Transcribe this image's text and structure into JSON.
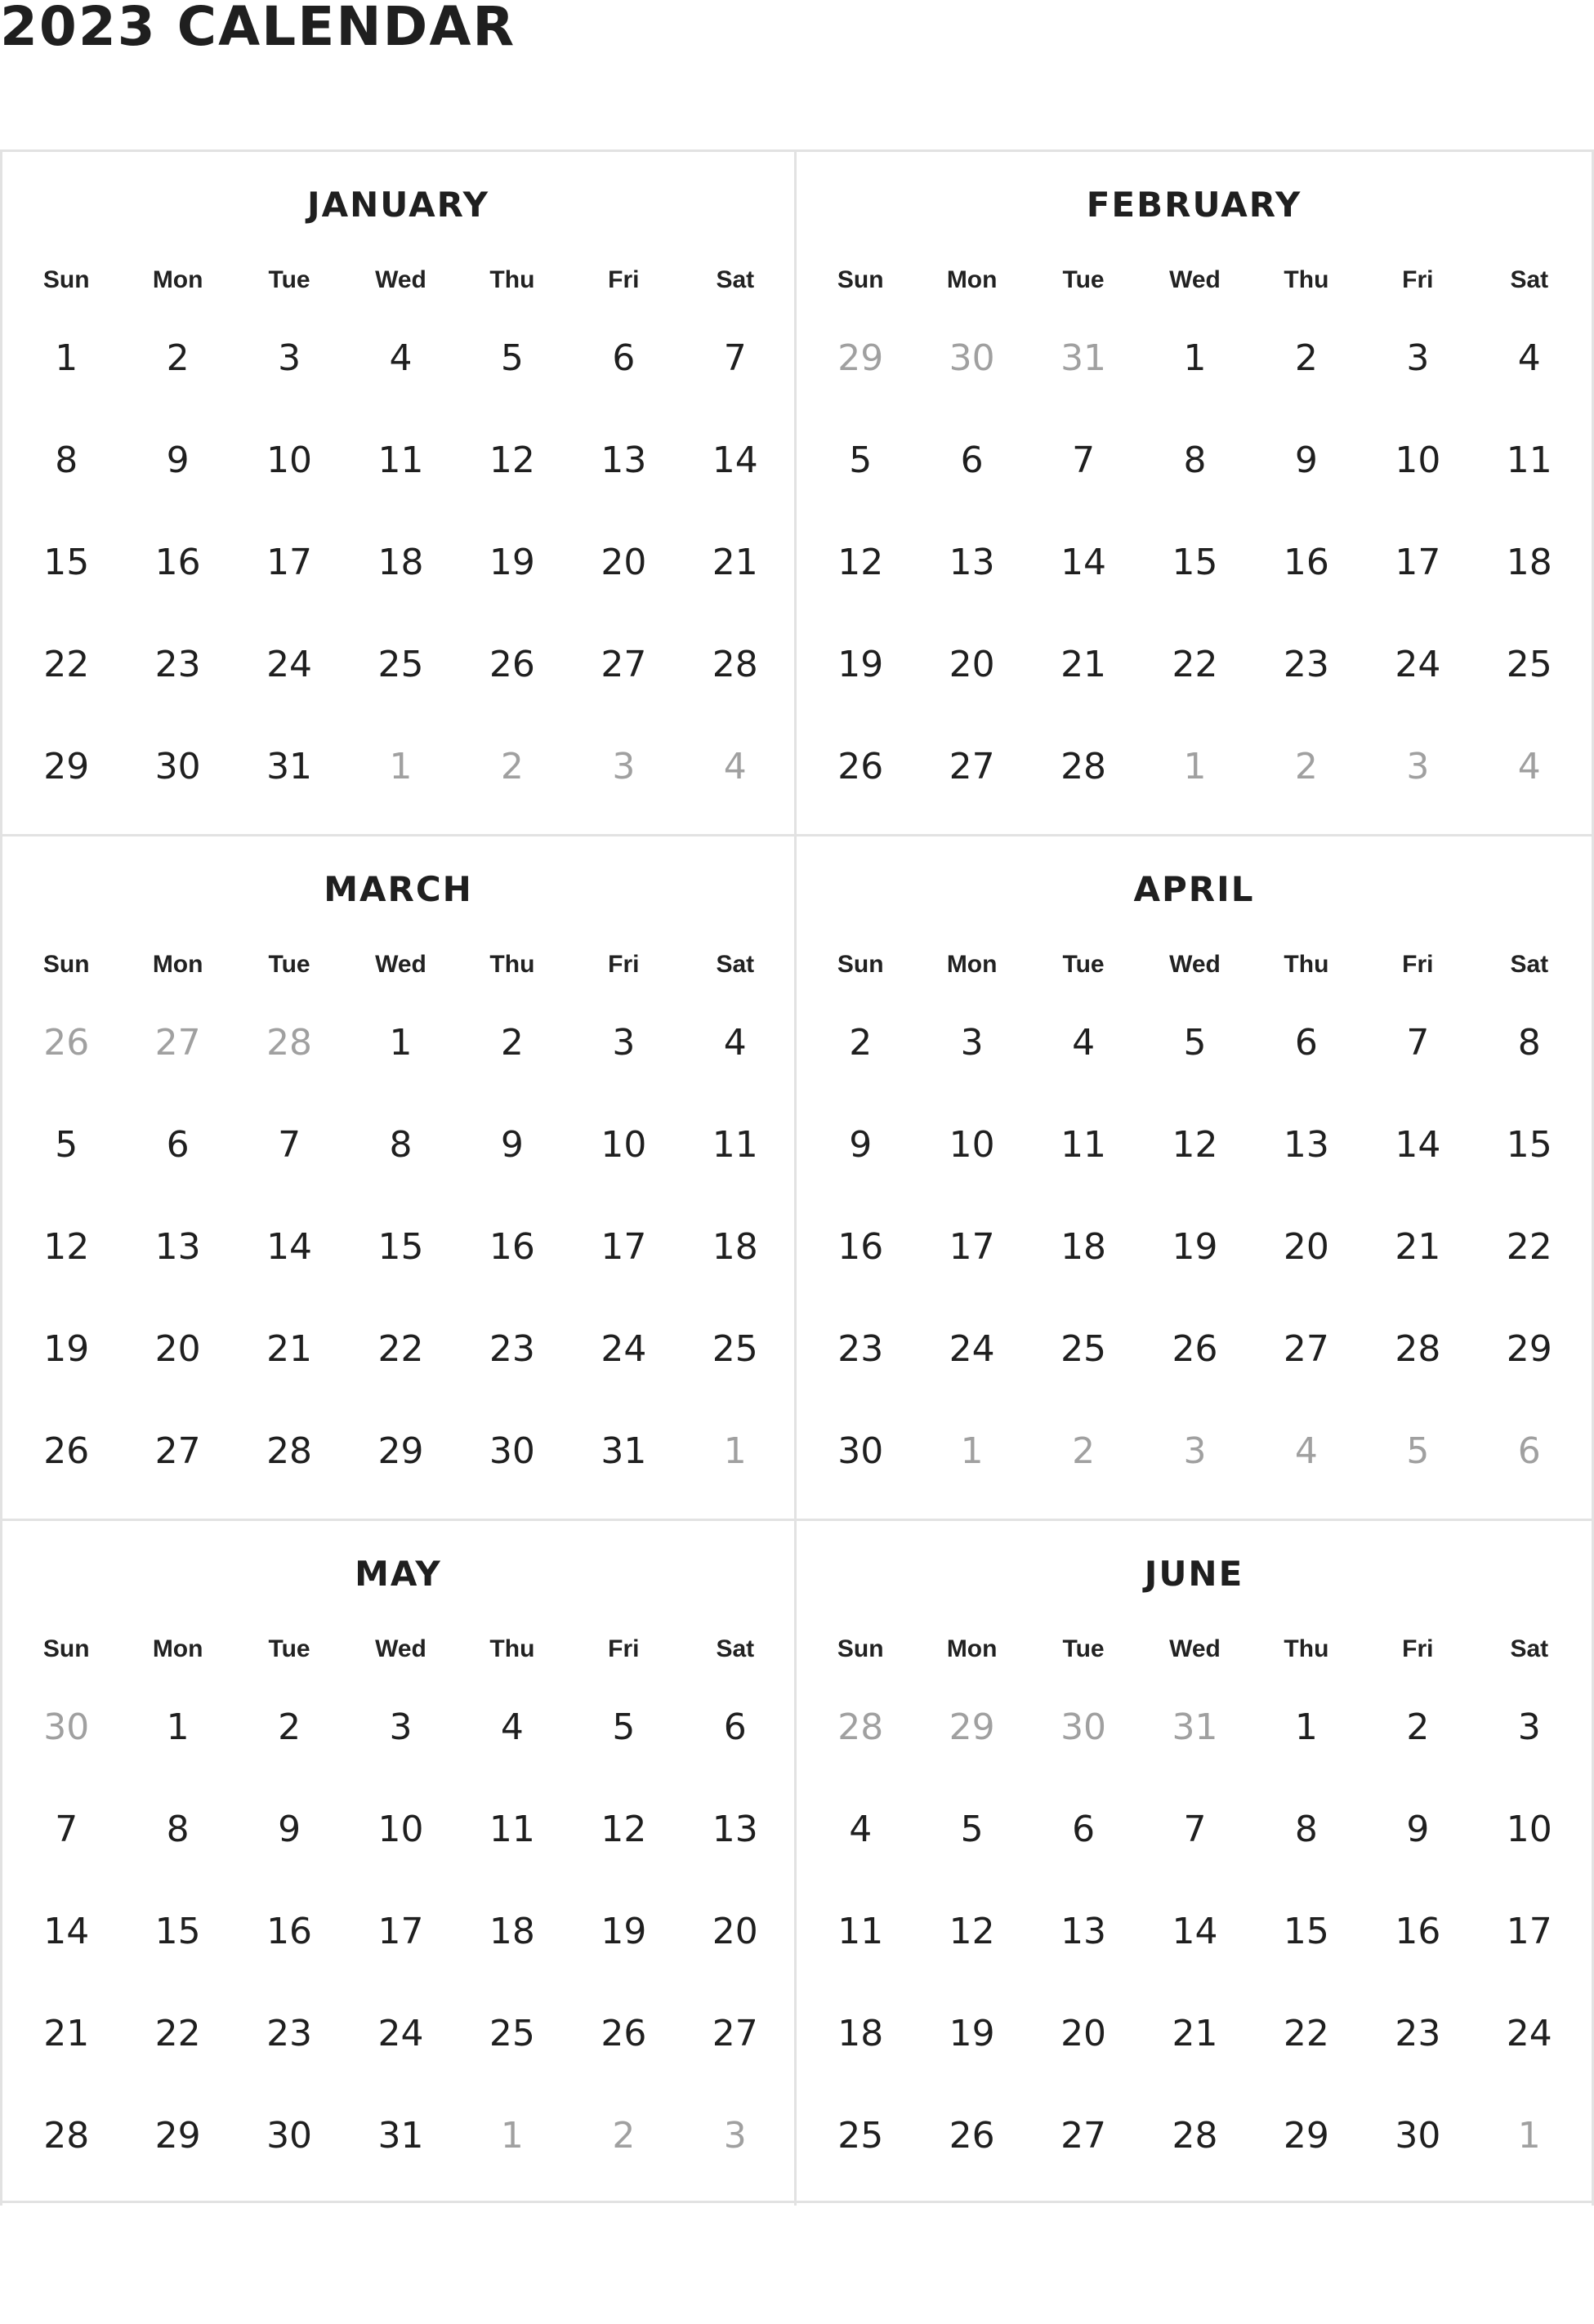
{
  "title": "2023 CALENDAR",
  "colors": {
    "text": "#1f1f1f",
    "muted": "#a0a0a0",
    "border": "#e2e2e2"
  },
  "weekdays": [
    "Sun",
    "Mon",
    "Tue",
    "Wed",
    "Thu",
    "Fri",
    "Sat"
  ],
  "months": [
    {
      "name": "JANUARY",
      "weeks": [
        [
          {
            "d": "1",
            "o": false
          },
          {
            "d": "2",
            "o": false
          },
          {
            "d": "3",
            "o": false
          },
          {
            "d": "4",
            "o": false
          },
          {
            "d": "5",
            "o": false
          },
          {
            "d": "6",
            "o": false
          },
          {
            "d": "7",
            "o": false
          }
        ],
        [
          {
            "d": "8",
            "o": false
          },
          {
            "d": "9",
            "o": false
          },
          {
            "d": "10",
            "o": false
          },
          {
            "d": "11",
            "o": false
          },
          {
            "d": "12",
            "o": false
          },
          {
            "d": "13",
            "o": false
          },
          {
            "d": "14",
            "o": false
          }
        ],
        [
          {
            "d": "15",
            "o": false
          },
          {
            "d": "16",
            "o": false
          },
          {
            "d": "17",
            "o": false
          },
          {
            "d": "18",
            "o": false
          },
          {
            "d": "19",
            "o": false
          },
          {
            "d": "20",
            "o": false
          },
          {
            "d": "21",
            "o": false
          }
        ],
        [
          {
            "d": "22",
            "o": false
          },
          {
            "d": "23",
            "o": false
          },
          {
            "d": "24",
            "o": false
          },
          {
            "d": "25",
            "o": false
          },
          {
            "d": "26",
            "o": false
          },
          {
            "d": "27",
            "o": false
          },
          {
            "d": "28",
            "o": false
          }
        ],
        [
          {
            "d": "29",
            "o": false
          },
          {
            "d": "30",
            "o": false
          },
          {
            "d": "31",
            "o": false
          },
          {
            "d": "1",
            "o": true
          },
          {
            "d": "2",
            "o": true
          },
          {
            "d": "3",
            "o": true
          },
          {
            "d": "4",
            "o": true
          }
        ]
      ]
    },
    {
      "name": "FEBRUARY",
      "weeks": [
        [
          {
            "d": "29",
            "o": true
          },
          {
            "d": "30",
            "o": true
          },
          {
            "d": "31",
            "o": true
          },
          {
            "d": "1",
            "o": false
          },
          {
            "d": "2",
            "o": false
          },
          {
            "d": "3",
            "o": false
          },
          {
            "d": "4",
            "o": false
          }
        ],
        [
          {
            "d": "5",
            "o": false
          },
          {
            "d": "6",
            "o": false
          },
          {
            "d": "7",
            "o": false
          },
          {
            "d": "8",
            "o": false
          },
          {
            "d": "9",
            "o": false
          },
          {
            "d": "10",
            "o": false
          },
          {
            "d": "11",
            "o": false
          }
        ],
        [
          {
            "d": "12",
            "o": false
          },
          {
            "d": "13",
            "o": false
          },
          {
            "d": "14",
            "o": false
          },
          {
            "d": "15",
            "o": false
          },
          {
            "d": "16",
            "o": false
          },
          {
            "d": "17",
            "o": false
          },
          {
            "d": "18",
            "o": false
          }
        ],
        [
          {
            "d": "19",
            "o": false
          },
          {
            "d": "20",
            "o": false
          },
          {
            "d": "21",
            "o": false
          },
          {
            "d": "22",
            "o": false
          },
          {
            "d": "23",
            "o": false
          },
          {
            "d": "24",
            "o": false
          },
          {
            "d": "25",
            "o": false
          }
        ],
        [
          {
            "d": "26",
            "o": false
          },
          {
            "d": "27",
            "o": false
          },
          {
            "d": "28",
            "o": false
          },
          {
            "d": "1",
            "o": true
          },
          {
            "d": "2",
            "o": true
          },
          {
            "d": "3",
            "o": true
          },
          {
            "d": "4",
            "o": true
          }
        ]
      ]
    },
    {
      "name": "MARCH",
      "weeks": [
        [
          {
            "d": "26",
            "o": true
          },
          {
            "d": "27",
            "o": true
          },
          {
            "d": "28",
            "o": true
          },
          {
            "d": "1",
            "o": false
          },
          {
            "d": "2",
            "o": false
          },
          {
            "d": "3",
            "o": false
          },
          {
            "d": "4",
            "o": false
          }
        ],
        [
          {
            "d": "5",
            "o": false
          },
          {
            "d": "6",
            "o": false
          },
          {
            "d": "7",
            "o": false
          },
          {
            "d": "8",
            "o": false
          },
          {
            "d": "9",
            "o": false
          },
          {
            "d": "10",
            "o": false
          },
          {
            "d": "11",
            "o": false
          }
        ],
        [
          {
            "d": "12",
            "o": false
          },
          {
            "d": "13",
            "o": false
          },
          {
            "d": "14",
            "o": false
          },
          {
            "d": "15",
            "o": false
          },
          {
            "d": "16",
            "o": false
          },
          {
            "d": "17",
            "o": false
          },
          {
            "d": "18",
            "o": false
          }
        ],
        [
          {
            "d": "19",
            "o": false
          },
          {
            "d": "20",
            "o": false
          },
          {
            "d": "21",
            "o": false
          },
          {
            "d": "22",
            "o": false
          },
          {
            "d": "23",
            "o": false
          },
          {
            "d": "24",
            "o": false
          },
          {
            "d": "25",
            "o": false
          }
        ],
        [
          {
            "d": "26",
            "o": false
          },
          {
            "d": "27",
            "o": false
          },
          {
            "d": "28",
            "o": false
          },
          {
            "d": "29",
            "o": false
          },
          {
            "d": "30",
            "o": false
          },
          {
            "d": "31",
            "o": false
          },
          {
            "d": "1",
            "o": true
          }
        ]
      ]
    },
    {
      "name": "APRIL",
      "weeks": [
        [
          {
            "d": "2",
            "o": false
          },
          {
            "d": "3",
            "o": false
          },
          {
            "d": "4",
            "o": false
          },
          {
            "d": "5",
            "o": false
          },
          {
            "d": "6",
            "o": false
          },
          {
            "d": "7",
            "o": false
          },
          {
            "d": "8",
            "o": false
          }
        ],
        [
          {
            "d": "9",
            "o": false
          },
          {
            "d": "10",
            "o": false
          },
          {
            "d": "11",
            "o": false
          },
          {
            "d": "12",
            "o": false
          },
          {
            "d": "13",
            "o": false
          },
          {
            "d": "14",
            "o": false
          },
          {
            "d": "15",
            "o": false
          }
        ],
        [
          {
            "d": "16",
            "o": false
          },
          {
            "d": "17",
            "o": false
          },
          {
            "d": "18",
            "o": false
          },
          {
            "d": "19",
            "o": false
          },
          {
            "d": "20",
            "o": false
          },
          {
            "d": "21",
            "o": false
          },
          {
            "d": "22",
            "o": false
          }
        ],
        [
          {
            "d": "23",
            "o": false
          },
          {
            "d": "24",
            "o": false
          },
          {
            "d": "25",
            "o": false
          },
          {
            "d": "26",
            "o": false
          },
          {
            "d": "27",
            "o": false
          },
          {
            "d": "28",
            "o": false
          },
          {
            "d": "29",
            "o": false
          }
        ],
        [
          {
            "d": "30",
            "o": false
          },
          {
            "d": "1",
            "o": true
          },
          {
            "d": "2",
            "o": true
          },
          {
            "d": "3",
            "o": true
          },
          {
            "d": "4",
            "o": true
          },
          {
            "d": "5",
            "o": true
          },
          {
            "d": "6",
            "o": true
          }
        ]
      ]
    },
    {
      "name": "MAY",
      "weeks": [
        [
          {
            "d": "30",
            "o": true
          },
          {
            "d": "1",
            "o": false
          },
          {
            "d": "2",
            "o": false
          },
          {
            "d": "3",
            "o": false
          },
          {
            "d": "4",
            "o": false
          },
          {
            "d": "5",
            "o": false
          },
          {
            "d": "6",
            "o": false
          }
        ],
        [
          {
            "d": "7",
            "o": false
          },
          {
            "d": "8",
            "o": false
          },
          {
            "d": "9",
            "o": false
          },
          {
            "d": "10",
            "o": false
          },
          {
            "d": "11",
            "o": false
          },
          {
            "d": "12",
            "o": false
          },
          {
            "d": "13",
            "o": false
          }
        ],
        [
          {
            "d": "14",
            "o": false
          },
          {
            "d": "15",
            "o": false
          },
          {
            "d": "16",
            "o": false
          },
          {
            "d": "17",
            "o": false
          },
          {
            "d": "18",
            "o": false
          },
          {
            "d": "19",
            "o": false
          },
          {
            "d": "20",
            "o": false
          }
        ],
        [
          {
            "d": "21",
            "o": false
          },
          {
            "d": "22",
            "o": false
          },
          {
            "d": "23",
            "o": false
          },
          {
            "d": "24",
            "o": false
          },
          {
            "d": "25",
            "o": false
          },
          {
            "d": "26",
            "o": false
          },
          {
            "d": "27",
            "o": false
          }
        ],
        [
          {
            "d": "28",
            "o": false
          },
          {
            "d": "29",
            "o": false
          },
          {
            "d": "30",
            "o": false
          },
          {
            "d": "31",
            "o": false
          },
          {
            "d": "1",
            "o": true
          },
          {
            "d": "2",
            "o": true
          },
          {
            "d": "3",
            "o": true
          }
        ]
      ]
    },
    {
      "name": "JUNE",
      "weeks": [
        [
          {
            "d": "28",
            "o": true
          },
          {
            "d": "29",
            "o": true
          },
          {
            "d": "30",
            "o": true
          },
          {
            "d": "31",
            "o": true
          },
          {
            "d": "1",
            "o": false
          },
          {
            "d": "2",
            "o": false
          },
          {
            "d": "3",
            "o": false
          }
        ],
        [
          {
            "d": "4",
            "o": false
          },
          {
            "d": "5",
            "o": false
          },
          {
            "d": "6",
            "o": false
          },
          {
            "d": "7",
            "o": false
          },
          {
            "d": "8",
            "o": false
          },
          {
            "d": "9",
            "o": false
          },
          {
            "d": "10",
            "o": false
          }
        ],
        [
          {
            "d": "11",
            "o": false
          },
          {
            "d": "12",
            "o": false
          },
          {
            "d": "13",
            "o": false
          },
          {
            "d": "14",
            "o": false
          },
          {
            "d": "15",
            "o": false
          },
          {
            "d": "16",
            "o": false
          },
          {
            "d": "17",
            "o": false
          }
        ],
        [
          {
            "d": "18",
            "o": false
          },
          {
            "d": "19",
            "o": false
          },
          {
            "d": "20",
            "o": false
          },
          {
            "d": "21",
            "o": false
          },
          {
            "d": "22",
            "o": false
          },
          {
            "d": "23",
            "o": false
          },
          {
            "d": "24",
            "o": false
          }
        ],
        [
          {
            "d": "25",
            "o": false
          },
          {
            "d": "26",
            "o": false
          },
          {
            "d": "27",
            "o": false
          },
          {
            "d": "28",
            "o": false
          },
          {
            "d": "29",
            "o": false
          },
          {
            "d": "30",
            "o": false
          },
          {
            "d": "1",
            "o": true
          }
        ]
      ]
    }
  ]
}
